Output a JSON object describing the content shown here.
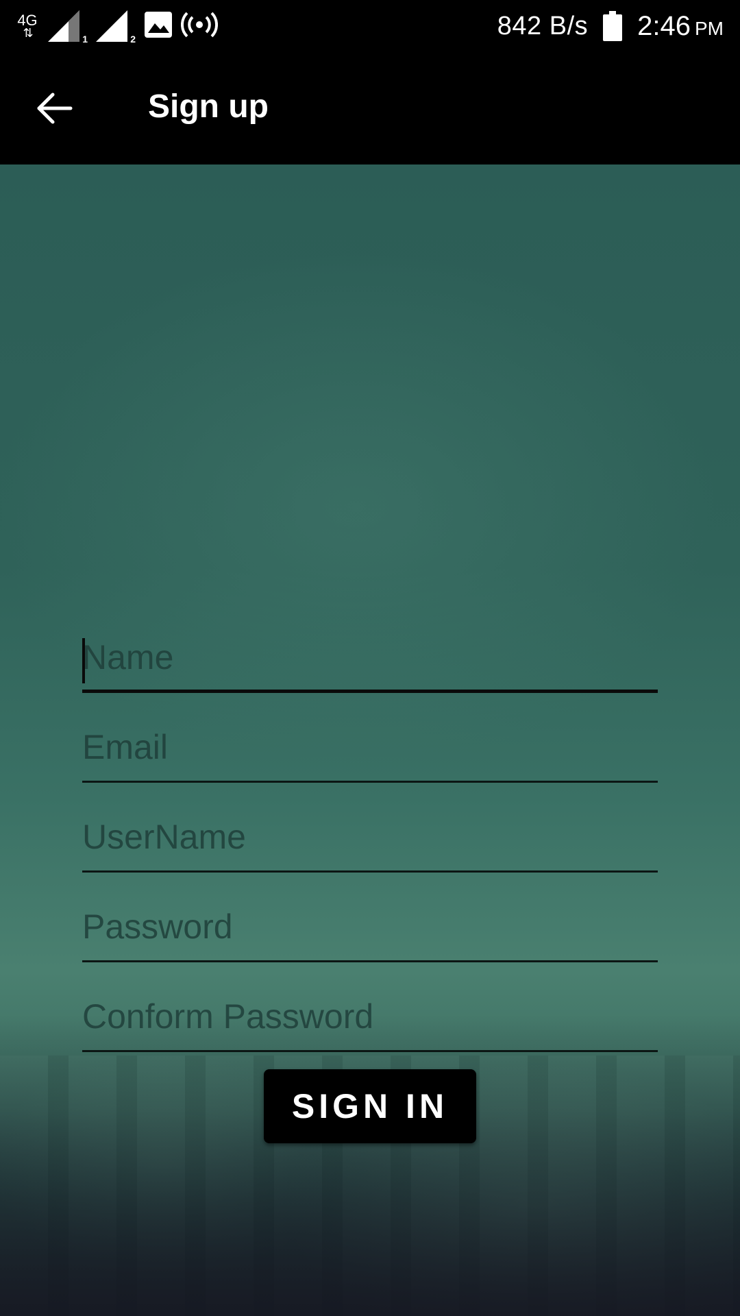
{
  "status_bar": {
    "network_type": "4G",
    "sim1_label": "1",
    "sim2_label": "2",
    "speed": "842 B/s",
    "time": "2:46",
    "ampm": "PM"
  },
  "toolbar": {
    "back_icon": "arrow-left-icon",
    "title": "Sign up"
  },
  "form": {
    "name_placeholder": "Name",
    "email_placeholder": "Email",
    "username_placeholder": "UserName",
    "password_placeholder": "Password",
    "confirm_password_placeholder": "Conform Password",
    "focused_field": "name"
  },
  "actions": {
    "signin_label": "SIGN IN"
  },
  "colors": {
    "toolbar_bg": "#000000",
    "background_teal": "#2f6259",
    "button_bg": "#000000"
  }
}
